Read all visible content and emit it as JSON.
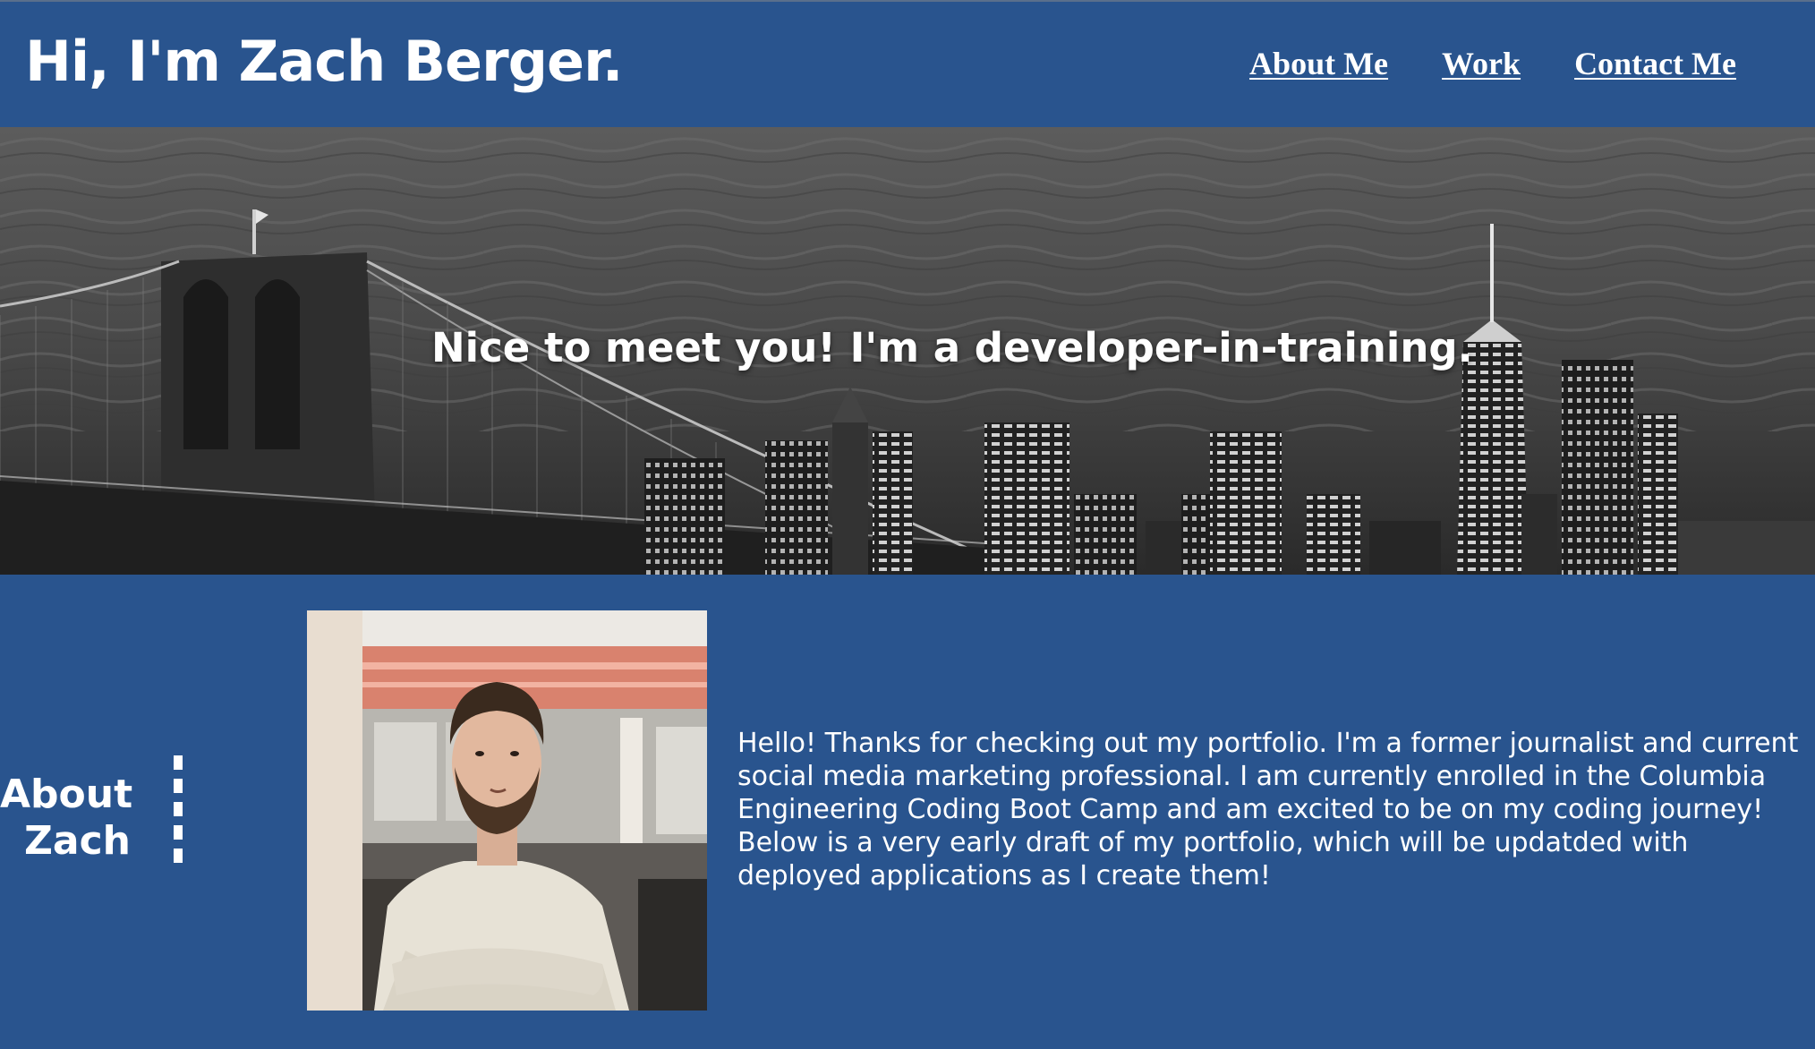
{
  "header": {
    "title": "Hi, I'm Zach Berger.",
    "nav": [
      {
        "label": "About Me"
      },
      {
        "label": "Work"
      },
      {
        "label": "Contact Me"
      }
    ]
  },
  "hero": {
    "tagline": "Nice to meet you! I'm a developer-in-training."
  },
  "about": {
    "heading_line1": "About",
    "heading_line2": "Zach",
    "body": "Hello! Thanks for checking out my portfolio. I'm a former journalist and current social media marketing professional. I am currently enrolled in the Columbia Engineering Coding Boot Camp and am excited to be on my coding journey! Below is a very early draft of my portfolio, which will be updatded with deployed applications as I create them!"
  },
  "colors": {
    "brand_blue": "#29548e",
    "text": "#ffffff"
  }
}
